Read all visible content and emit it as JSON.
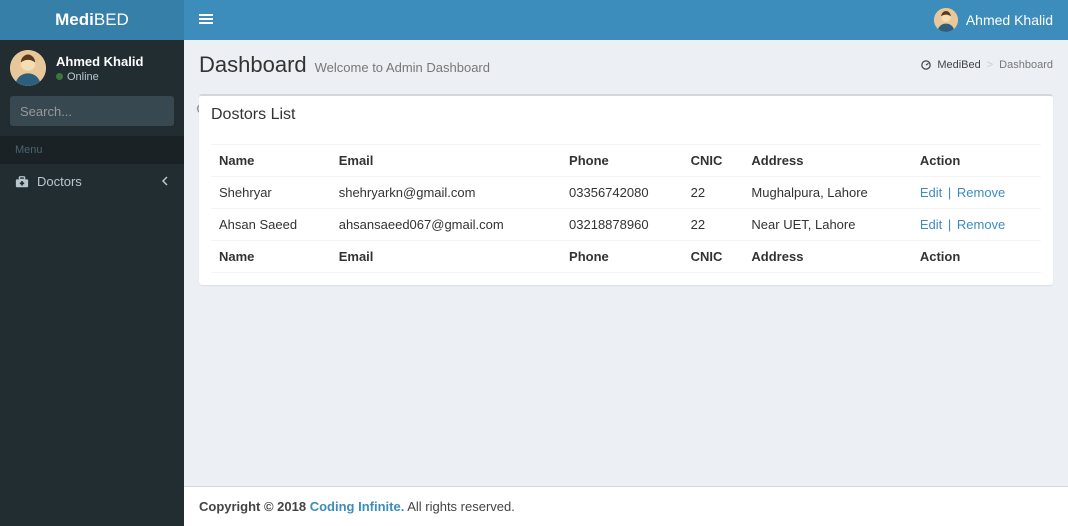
{
  "brand": {
    "text1": "Medi",
    "text2": "BED"
  },
  "header": {
    "user_name": "Ahmed Khalid"
  },
  "sidebar": {
    "user": {
      "name": "Ahmed Khalid",
      "status": "Online"
    },
    "search": {
      "placeholder": "Search..."
    },
    "menu_header": "Menu",
    "items": [
      {
        "label": "Doctors"
      }
    ]
  },
  "page": {
    "title": "Dashboard",
    "subtitle": "Welcome to Admin Dashboard"
  },
  "breadcrumb": {
    "root": "MediBed",
    "current": "Dashboard"
  },
  "panel": {
    "title": "Dostors List",
    "columns": {
      "name": "Name",
      "email": "Email",
      "phone": "Phone",
      "cnic": "CNIC",
      "address": "Address",
      "action": "Action"
    },
    "rows": [
      {
        "name": "Shehryar",
        "email": "shehryarkn@gmail.com",
        "phone": "03356742080",
        "cnic": "22",
        "address": "Mughalpura, Lahore"
      },
      {
        "name": "Ahsan Saeed",
        "email": "ahsansaeed067@gmail.com",
        "phone": "03218878960",
        "cnic": "22",
        "address": "Near UET, Lahore"
      }
    ],
    "actions": {
      "edit": "Edit",
      "remove": "Remove"
    }
  },
  "footer": {
    "copyright_prefix": "Copyright © 2018 ",
    "link_text": "Coding Infinite.",
    "suffix": " All rights reserved."
  }
}
